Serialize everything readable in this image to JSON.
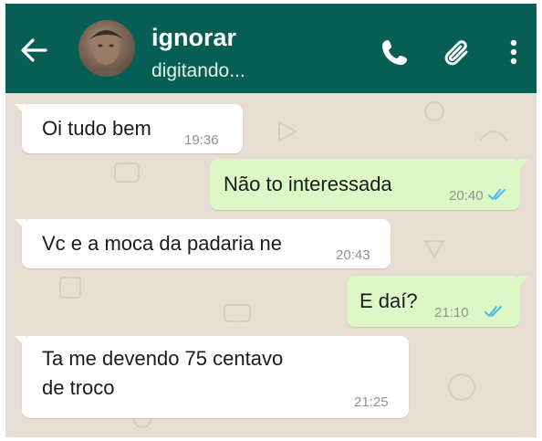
{
  "header": {
    "contact_name": "ignorar",
    "contact_status": "digitando...",
    "back_icon": "arrow-left-icon",
    "call_icon": "phone-icon",
    "attach_icon": "paperclip-icon",
    "menu_icon": "more-vertical-icon"
  },
  "messages": [
    {
      "direction": "incoming",
      "text": "Oi tudo bem",
      "time": "19:36"
    },
    {
      "direction": "outgoing",
      "text": "Não to interessada",
      "time": "20:40",
      "status": "read"
    },
    {
      "direction": "incoming",
      "text": "Vc e a moca da padaria ne",
      "time": "20:43"
    },
    {
      "direction": "outgoing",
      "text": "E daí?",
      "time": "21:10",
      "status": "read"
    },
    {
      "direction": "incoming",
      "text_line1": "Ta me devendo 75 centavo",
      "text_line2": "de troco",
      "time": "21:25"
    }
  ],
  "colors": {
    "header": "#075e54",
    "chat_background": "#e7ded3",
    "incoming_bubble": "#ffffff",
    "outgoing_bubble": "#dcf8c6",
    "read_ticks": "#4fb6ec"
  }
}
